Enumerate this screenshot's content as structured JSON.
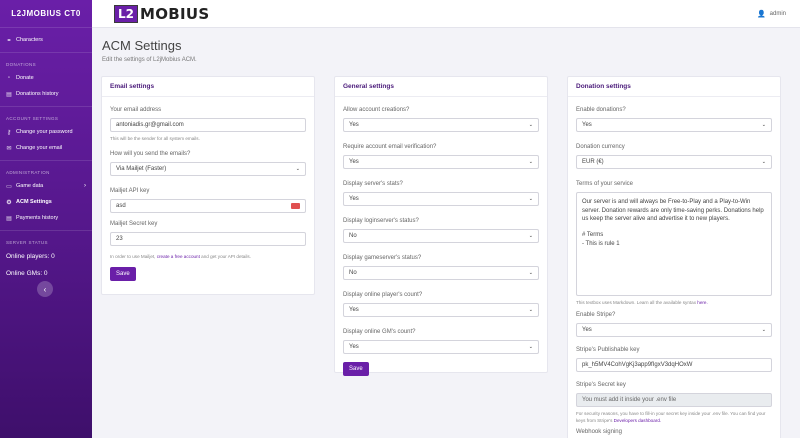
{
  "sidebar": {
    "brand": "L2JMOBIUS CT0",
    "characters": "Characters",
    "donations_heading": "DONATIONS",
    "donate": "Donate",
    "donations_history": "Donations history",
    "account_heading": "ACCOUNT SETTINGS",
    "change_password": "Change your password",
    "change_email": "Change your email",
    "admin_heading": "ADMINISTRATION",
    "game_data": "Game data",
    "acm_settings": "ACM Settings",
    "payments_history": "Payments history",
    "server_heading": "SERVER STATUS",
    "online_players": "Online players: 0",
    "online_gms": "Online GMs: 0",
    "collapse_glyph": "‹"
  },
  "topbar": {
    "logo_mark": "L2",
    "logo_text": "MOBIUS",
    "user_name": "admin"
  },
  "page": {
    "title": "ACM Settings",
    "subtitle": "Edit the settings of L2jMobius ACM."
  },
  "email": {
    "title": "Email settings",
    "address_label": "Your email address",
    "address_value": "antoniadis.gr@gmail.com",
    "address_help": "This will be the sender for all system emails.",
    "method_label": "How will you send the emails?",
    "method_value": "Via Mailjet (Faster)",
    "api_label": "Mailjet API key",
    "api_value": "asd",
    "secret_label": "Mailjet Secret key",
    "secret_value": "23",
    "help_pre": "In order to use Mailjet,",
    "help_link": "create a free account",
    "help_post": "and get your API details.",
    "save": "Save"
  },
  "general": {
    "title": "General settings",
    "fields": [
      {
        "label": "Allow account creations?",
        "value": "Yes"
      },
      {
        "label": "Require account email verification?",
        "value": "Yes"
      },
      {
        "label": "Display server's stats?",
        "value": "Yes"
      },
      {
        "label": "Display loginserver's status?",
        "value": "No"
      },
      {
        "label": "Display gameserver's status?",
        "value": "No"
      },
      {
        "label": "Display online player's count?",
        "value": "Yes"
      },
      {
        "label": "Display online GM's count?",
        "value": "Yes"
      }
    ],
    "save": "Save"
  },
  "donation": {
    "title": "Donation settings",
    "enable_label": "Enable donations?",
    "enable_value": "Yes",
    "currency_label": "Donation currency",
    "currency_value": "EUR (€)",
    "terms_label": "Terms of your service",
    "terms_p1": "Our server is and will always be Free-to-Play and a Play-to-Win server. Donation rewards are only time-saving perks. Donations help us keep the server alive and advertise it to new players.",
    "terms_h": "# Terms",
    "terms_li": "- This is rule 1",
    "markdown_pre": "This textbox uses Markdown. Learn all the available syntax",
    "markdown_link": "here.",
    "stripe_label": "Enable Stripe?",
    "stripe_value": "Yes",
    "pub_label": "Stripe's Publishable key",
    "pub_value": "pk_h5MV4CohVgKj3app9fIgxV3dqHOxW",
    "secret_label": "Stripe's Secret key",
    "secret_value": "You must add it inside your .env file",
    "secret_help_pre": "For security reasons, you have to fill-in your secret key inside your .env file. You can find your keys from Stripe's",
    "secret_help_link": "Developers dashboard.",
    "cut_label": "Webhook signing"
  },
  "colors": {
    "accent": "#6a1fa8"
  }
}
